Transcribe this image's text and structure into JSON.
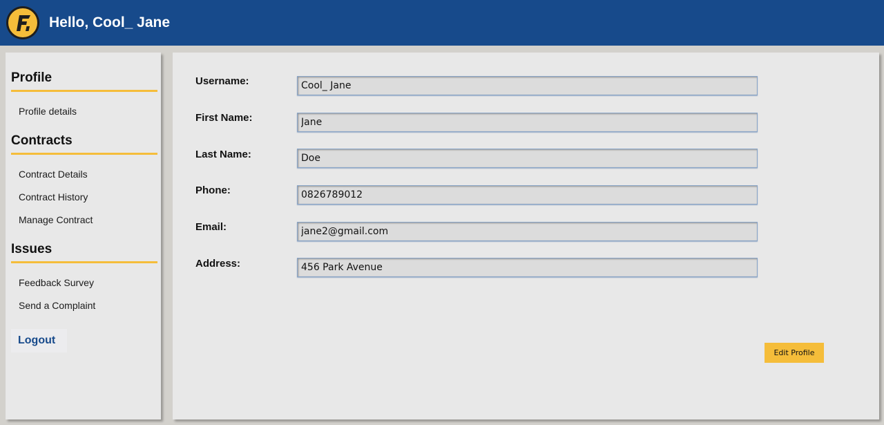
{
  "header": {
    "greeting": "Hello, Cool_ Jane",
    "logo_icon": "company-logo-icon",
    "colors": {
      "bar": "#174a8b",
      "accent": "#f5bd3a"
    }
  },
  "sidebar": {
    "sections": [
      {
        "title": "Profile",
        "items": [
          "Profile details"
        ]
      },
      {
        "title": "Contracts",
        "items": [
          "Contract Details",
          "Contract History",
          "Manage Contract"
        ]
      },
      {
        "title": "Issues",
        "items": [
          "Feedback Survey",
          "Send a Complaint"
        ]
      }
    ],
    "logout_label": "Logout"
  },
  "form": {
    "fields": [
      {
        "label": "Username:",
        "value": "Cool_ Jane"
      },
      {
        "label": "First Name:",
        "value": "Jane"
      },
      {
        "label": "Last Name:",
        "value": "Doe"
      },
      {
        "label": "Phone:",
        "value": "0826789012"
      },
      {
        "label": "Email:",
        "value": "jane2@gmail.com"
      },
      {
        "label": "Address:",
        "value": "456 Park Avenue"
      }
    ],
    "edit_label": "Edit Profile"
  }
}
